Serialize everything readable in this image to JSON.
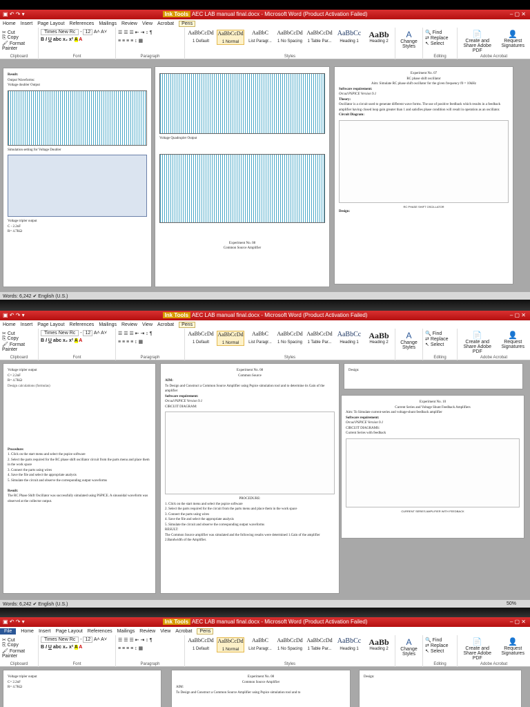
{
  "window": {
    "title": "AEC LAB manual final.docx - Microsoft Word (Product Activation Failed)",
    "ink_tools": "Ink Tools"
  },
  "tabs": [
    "File",
    "Home",
    "Insert",
    "Page Layout",
    "References",
    "Mailings",
    "Review",
    "View",
    "Acrobat",
    "Pens"
  ],
  "clipboard": {
    "cut": "Cut",
    "copy": "Copy",
    "format_painter": "Format Painter",
    "label": "Clipboard"
  },
  "font": {
    "name": "Times New Rc",
    "size": "12",
    "label": "Font"
  },
  "paragraph": {
    "label": "Paragraph"
  },
  "styles": {
    "label": "Styles",
    "items": [
      {
        "preview": "AaBbCcDd",
        "name": "1 Default"
      },
      {
        "preview": "AaBbCcDd",
        "name": "1 Normal"
      },
      {
        "preview": "AaBbC",
        "name": "List Paragr..."
      },
      {
        "preview": "AaBbCcDd",
        "name": "1 No Spacing"
      },
      {
        "preview": "AaBbCcDd",
        "name": "1 Table Par..."
      },
      {
        "preview": "AaBbCc",
        "name": "Heading 1"
      },
      {
        "preview": "AaBb",
        "name": "Heading 2"
      }
    ],
    "change": "Change Styles"
  },
  "editing": {
    "find": "Find",
    "replace": "Replace",
    "select": "Select",
    "label": "Editing"
  },
  "acrobat": {
    "create": "Create and Share Adobe PDF",
    "request": "Request Signatures",
    "label": "Adobe Acrobat"
  },
  "status": {
    "words": "Words: 6,242",
    "lang": "English (U.S.)",
    "zoom": "50%"
  },
  "pages1": {
    "p1": {
      "l1": "Result:",
      "l2": "Output Waveforms:",
      "l3": "Voltage doubler Output",
      "l4": "Simulation setting for Voltage Doubler",
      "l5": "Voltage tripler output",
      "l6": "C - 2.2nF",
      "l7": "R= 4.7KΩ"
    },
    "p2": {
      "l1": "Voltage Quadrupler Output",
      "l2": "Experiment No. 08",
      "l3": "Common Source Amplifier"
    },
    "p3": {
      "l1": "Experiment No. 07",
      "l2": "RC phase shift oscillator",
      "l3": "Aim: Simulate RC phase shift oscillator for the given frequency f0 = 10kHz",
      "l4": "Software requirement:",
      "l5": "Orcad PSPICE Version 9.1",
      "l6": "Theory:",
      "l7": "Oscillator is a circuit used to generate different wave forms. The use of positive feedback which results in a feedback amplifier having closed loop gain greater than 1 and satisfies phase condition will result in operation as an oscillator.",
      "l8": "Circuit Diagram:",
      "l9": "RC PHASE SHIFT OSCILLATOR",
      "l10": "Design:"
    }
  },
  "pages2": {
    "p1": {
      "l1": "Voltage tripler output",
      "l2": "C= 2.2nF",
      "l3": "R= 4.7KΩ",
      "l4": "Procedure:",
      "l5": "1. Click on the start menu and select the pspice software",
      "l6": "2. Select the parts required for the RC phase shift oscillator circuit from the parts menu and place them in the work space",
      "l7": "3. Connect the parts using wires",
      "l8": "4. Save the file and select the appropriate analysis",
      "l9": "5. Simulate the circuit and observe the corresponding output waveforms",
      "l10": "Result:",
      "l11": "The RC Phase Shift Oscillator was successfully simulated using PSPICE. A sinusoidal waveform was observed at the collector output."
    },
    "p2": {
      "l1": "Experiment No. 08",
      "l2": "Common Source",
      "l3": "AIM:",
      "l4": "To Design and Construct a Common Source Amplifier using Pspice simulation tool and to determine its Gain of the amplifier",
      "l5": "Software requirement:",
      "l6": "Orcad PSPICE Version 9.1",
      "l7": "CIRCUIT DIAGRAM:",
      "l8": "PROCEDURE:",
      "l9": "1. Click on the start menu and select the pspice software",
      "l10": "2. Select the parts required for the circuit from the parts menu and place them in the work space",
      "l11": "3. Connect the parts using wires",
      "l12": "4. Save the file and select the appropriate analysis",
      "l13": "5. Simulate the circuit and observe the corresponding output waveforms",
      "l14": "RESULT:",
      "l15": "The Common Source amplifier was simulated and the following results were determined 1.Gain of the amplifier 2.Bandwidth of the Amplifier."
    },
    "p3": {
      "l1": "Design:"
    },
    "p4": {
      "l1": "Experiment No. 10",
      "l2": "Current Series and Voltage Shunt Feedback Amplifiers",
      "l3": "Aim: To Simulate current-series and voltage-shunt feedback amplifier",
      "l4": "Software requirement:",
      "l5": "Orcad PSPICE Version 9.1",
      "l6": "CIRCUIT DIAGRAMS:",
      "l7": "Current Series with feedback",
      "l8": "CURRENT SERIES AMPLIFIER WITH FEEDBACK"
    }
  },
  "pages3": {
    "p1": {
      "l1": "Voltage tripler output",
      "l2": "C= 2.2nF",
      "l3": "R= 4.7KΩ"
    },
    "p2": {
      "l1": "Experiment No. 08",
      "l2": "Common Source Amplifier",
      "l3": "AIM:",
      "l4": "To Design and Construct a Common Source Amplifier using Pspice simulation tool and to"
    },
    "p3": {
      "l1": "Design:"
    }
  }
}
